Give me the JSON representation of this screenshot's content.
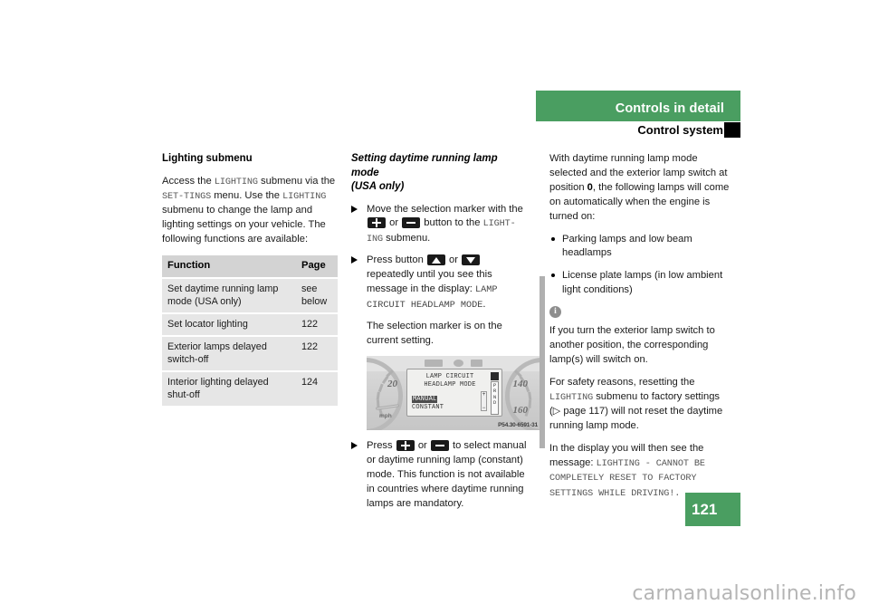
{
  "header": {
    "section_title": "Controls in detail",
    "sub_title": "Control system"
  },
  "page_number": "121",
  "watermark": "carmanualsonline.info",
  "column_left": {
    "heading": "Lighting submenu",
    "intro_1": "Access the ",
    "intro_mono_1": "LIGHTING",
    "intro_2": " submenu via the ",
    "intro_mono_2": "SET-TINGS",
    "intro_3": " menu. Use the ",
    "intro_mono_3": "LIGHTING",
    "intro_4": " submenu to change the lamp and lighting settings on your vehicle. The following functions are available:",
    "table": {
      "headers": [
        "Function",
        "Page"
      ],
      "rows": [
        {
          "function": "Set daytime running lamp mode (USA only)",
          "page": "see below"
        },
        {
          "function": "Set locator lighting",
          "page": "122"
        },
        {
          "function": "Exterior lamps delayed switch-off",
          "page": "122"
        },
        {
          "function": "Interior lighting delayed shut-off",
          "page": "124"
        }
      ]
    }
  },
  "column_middle": {
    "heading_line1": "Setting daytime running lamp mode",
    "heading_line2": "(USA only)",
    "step1_a": "Move the selection marker with the ",
    "step1_b": " or ",
    "step1_c": " button to the ",
    "step1_mono": "LIGHT-ING",
    "step1_d": " submenu.",
    "step2_a": "Press button ",
    "step2_b": " or ",
    "step2_c": " repeatedly until you see this message in the display: ",
    "step2_mono": "LAMP CIRCUIT HEADLAMP MODE",
    "step2_d": ".",
    "note": "The selection marker is on the current setting.",
    "step3_a": "Press ",
    "step3_b": " or ",
    "step3_c": " to select manual or daytime running lamp (constant) mode. This function is not available in countries where daytime running lamps are mandatory.",
    "figure": {
      "caption_code": "P54.30-6591-31",
      "gauge_left_value": "20",
      "gauge_left_unit": "mph",
      "gauge_right_value_1": "140",
      "gauge_right_value_2": "160",
      "lcd_title_line1": "LAMP CIRCUIT",
      "lcd_title_line2": "HEADLAMP MODE",
      "lcd_option_selected": "MANUAL",
      "lcd_option_other": "CONSTANT",
      "lcd_gear_indicator": "PRND"
    },
    "keys": {
      "plus": "plus-button",
      "minus": "minus-button",
      "up": "up-arrow-button",
      "down": "down-arrow-button"
    }
  },
  "column_right": {
    "para_1_a": "With daytime running lamp mode selected and the exterior lamp switch at position ",
    "para_1_bold": "0",
    "para_1_b": ", the following lamps will come on automatically when the engine is turned on:",
    "bullets": [
      "Parking lamps and low beam headlamps",
      "License plate lamps (in low ambient light conditions)"
    ],
    "info": {
      "icon": "info-icon",
      "para_1": "If you turn the exterior lamp switch to another position, the corresponding lamp(s) will switch on.",
      "para_2_a": "For safety reasons, resetting the ",
      "para_2_mono": "LIGHTING",
      "para_2_b": " submenu to factory settings (▷ page 117) will not reset the daytime running lamp mode.",
      "para_3_a": "In the display you will then see the message: ",
      "para_3_mono": "LIGHTING - CANNOT BE COMPLETELY RESET TO FACTORY SETTINGS WHILE DRIVING!."
    }
  },
  "colors": {
    "brand_green": "#4a9e61",
    "table_header_gray": "#d3d3d3",
    "table_cell_gray": "#e6e6e6"
  }
}
